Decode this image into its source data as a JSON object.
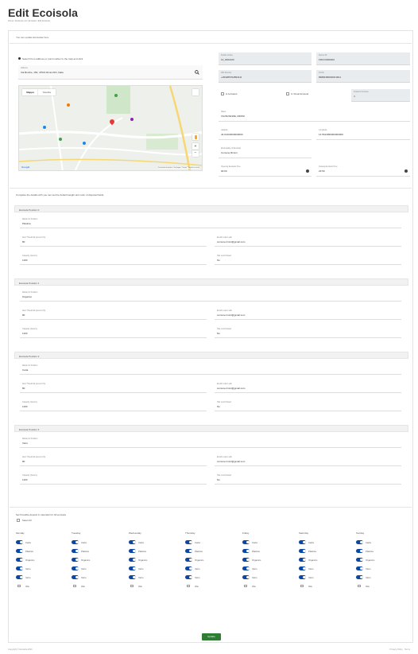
{
  "page": {
    "title": "Edit Ecoisola",
    "breadcrumb": "Home / Ecoisole List / Ecoisole / Edit Ecoisola",
    "notice": "You can update Ecoisolas here."
  },
  "map_section": {
    "search_hint": "Search from address or point marker in the map and click",
    "address_label": "Address",
    "address_value": "Via Bonfire, 150, 47521 Rimini RN, Italia",
    "tab_map": "Mappa",
    "tab_satellite": "Satellite",
    "footer_left": "Google",
    "footer_right": "Scorciatoie da tastiera · Dati mappa · Termini · Segnala un errore"
  },
  "details": {
    "serial_label": "Serial number",
    "serial_value": "13_0002100",
    "device_label": "Device ID",
    "device_value": "FRCC0000002",
    "sim_label": "SIM Number",
    "sim_value": "+393285762893111",
    "iccid_label": "ICCID",
    "iccid_value": "89882380000010011",
    "check1_label": "Is Activated",
    "check2_label": "Is Virtual Ecoisola",
    "positions_label": "Positions Number",
    "positions_value": "4",
    "name_label": "Name",
    "name_value": "VIA BONFIRE, RIMINI",
    "lat_label": "Latitude",
    "lat_value": "44.04103000000000",
    "lng_label": "Longitude",
    "lng_value": "12.5613996000000000",
    "municipality_label": "Municipality of Ecoisola",
    "municipality_value": "Comune Rimini",
    "open_label": "Opening Ecoisola Time",
    "open_value": "00:00",
    "close_label": "Closing Ecoisola Time",
    "close_value": "23:59"
  },
  "positions_hint": "Complete the details with you can set the default weight and color of disposal fields.",
  "positions": [
    {
      "header": "Ecoisola Position 0",
      "waste_label": "Waste for Position",
      "waste_value": "Plastica",
      "threshold_label": "Alert Threshold percent (%)",
      "threshold_value": "80",
      "email_label": "Email to alert with",
      "email_value": "comune.rimini@gmail.com",
      "capacity_label": "Capacity (Grams)",
      "capacity_value": "1100",
      "lock_label": "Has Lock Drawer",
      "lock_value": "No"
    },
    {
      "header": "Ecoisola Position 1",
      "waste_label": "Waste for Position",
      "waste_value": "Organico",
      "threshold_label": "Alert Threshold percent (%)",
      "threshold_value": "80",
      "email_label": "Email to alert with",
      "email_value": "comune.rimini@gmail.com",
      "capacity_label": "Capacity (Grams)",
      "capacity_value": "1100",
      "lock_label": "Has Lock Drawer",
      "lock_value": "No"
    },
    {
      "header": "Ecoisola Position 2",
      "waste_label": "Waste for Position",
      "waste_value": "Carta",
      "threshold_label": "Alert Threshold percent (%)",
      "threshold_value": "80",
      "email_label": "Email to alert with",
      "email_value": "comune.rimini@gmail.com",
      "capacity_label": "Capacity (Grams)",
      "capacity_value": "1100",
      "lock_label": "Has Lock Drawer",
      "lock_value": "No"
    },
    {
      "header": "Ecoisola Position 3",
      "waste_label": "Waste for Position",
      "waste_value": "Vetro",
      "threshold_label": "Alert Threshold percent (%)",
      "threshold_value": "80",
      "email_label": "Email to alert with",
      "email_value": "comune.rimini@gmail.com",
      "capacity_label": "Capacity (Grams)",
      "capacity_value": "1100",
      "lock_label": "Has Lock Drawer",
      "lock_value": "No"
    }
  ],
  "schedule": {
    "hint": "Set Possible deposit in calendar for All ecoisola",
    "select_all": "Select All",
    "days": [
      "Monday",
      "Tuesday",
      "Wednesday",
      "Thursday",
      "Friday",
      "Saturday",
      "Sunday"
    ],
    "items": [
      "Carta",
      "Plastica",
      "Organico",
      "Vetro",
      "Vetro"
    ],
    "last_item": "Olio"
  },
  "actions": {
    "update_label": "Update"
  },
  "footer": {
    "left": "Copyright © Ecoisola 2021",
    "right": "Privacy Policy · Terms"
  }
}
